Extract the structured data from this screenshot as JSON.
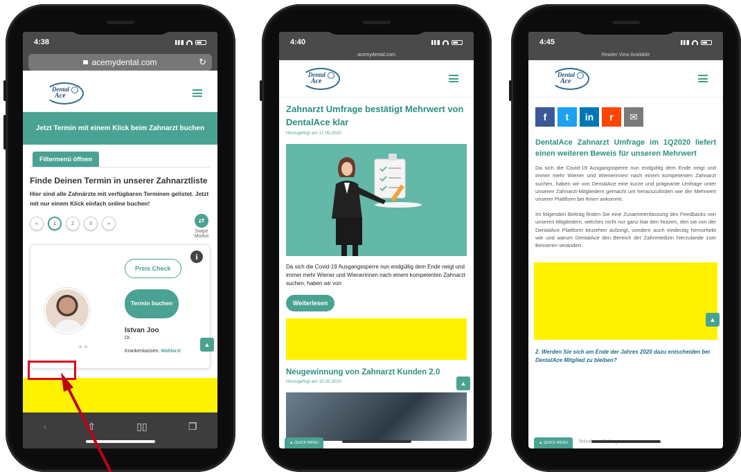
{
  "phone1": {
    "status": {
      "time": "4:38"
    },
    "url": "acemydental.com",
    "banner": "Jetzt Termin mit einem Klick beim Zahnarzt buchen",
    "filter_button": "Filtermenü öffnen",
    "heading": "Finde Deinen Termin in unserer Zahnarztliste",
    "intro": "Hier sind alle Zahnärzte mit verfügbaren Terminen gelistet. Jetzt mit nur einem Klick einfach online buchen!",
    "pager": [
      "«",
      "1",
      "2",
      "3",
      "»"
    ],
    "swipe_label": "Swipe Modus",
    "card": {
      "price_button": "Preis Check",
      "book_button": "Termin buchen",
      "doctor_name": "Istvan Joo",
      "doctor_title": "Dr.",
      "insurance_label": "Krankenkassen:",
      "insurance_value": "Wahlarzt"
    }
  },
  "phone2": {
    "status": {
      "time": "4:40"
    },
    "url": "acemydental.com",
    "article1": {
      "title": "Zahnarzt Umfrage bestätigt Mehrwert von DentalAce klar",
      "date": "Hinzugefügt am 17.05.2020",
      "excerpt": "Da sich die Covid-19 Ausgangssperre nun endgültig dem Ende neigt und immer mehr Wiener und Wienerinnen nach einem kompetenten Zahnarzt suchen, haben wir von",
      "read_more": "Weiterlesen"
    },
    "article2": {
      "title": "Neugewinnung von Zahnarzt Kunden 2.0",
      "date": "Hinzugefügt am 15.05.2020"
    },
    "quick_menu": "QUICK MENU"
  },
  "phone3": {
    "status": {
      "time": "4:45"
    },
    "reader": "Reader View Available",
    "share": [
      {
        "icon": "facebook-icon",
        "glyph": "f",
        "color": "#3b5998"
      },
      {
        "icon": "twitter-icon",
        "glyph": "t",
        "color": "#1da1f2"
      },
      {
        "icon": "linkedin-icon",
        "glyph": "in",
        "color": "#0077b5"
      },
      {
        "icon": "reddit-icon",
        "glyph": "r",
        "color": "#ff4500"
      },
      {
        "icon": "email-icon",
        "glyph": "✉",
        "color": "#7a7a7a"
      }
    ],
    "title": "DentalAce Zahnarzt Umfrage im 1Q2020 liefert einen weiteren Beweis für unseren Mehrwert",
    "para1": "Da sich die Covid-19 Ausgangssperre nun endgültig dem Ende neigt und immer mehr Wiener und Wienerinnen nach einem kompetenten Zahnarzt suchen, haben wir von DentalAce eine kurze und prägnante Umfrage unter unseren Zahnarzt-Mitgliedern gemacht um herauszufinden wie der Mehrwert unserer Plattform bei ihnen ankommt.",
    "para2": "Im folgenden Beitrag finden Sie eine Zusammenfassung des Feedbacks von unseren Mitgliedern, welches nicht nur ganz klar den Nutzen, den sie von der DentalAce Plattform beziehen aufzeigt, sondern auch eindeutig hervorhebt wie und warum DentalAce den Bereich der Zahnmedizin hierzulande zum Besseren verändert.",
    "question": "2. Werden Sie sich am Ende der Jahres 2020 dazu entscheiden bei DentalAce Mitglied zu bleiben?",
    "quick_menu": "QUICK MENU",
    "bottom_text": "Teilnehmer Befragten"
  },
  "logo": {
    "line1": "Dental",
    "line2": "Ace"
  },
  "colors": {
    "teal": "#4aa292",
    "yellow": "#fff200",
    "annotation": "#e0001b"
  }
}
